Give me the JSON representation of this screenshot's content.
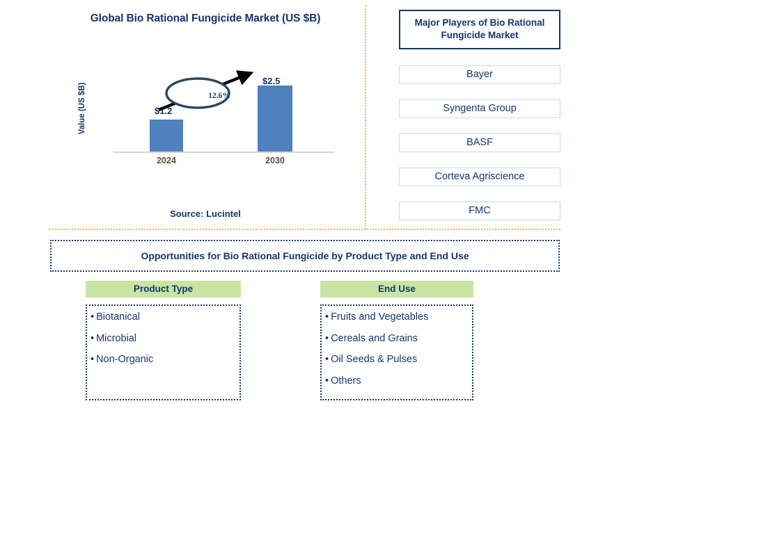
{
  "chart_panel": {
    "title": "Global Bio Rational Fungicide Market (US $B)",
    "y_axis_label": "Value (US $B)",
    "source": "Source: Lucintel",
    "cagr_label": "12.6%"
  },
  "chart_data": {
    "type": "bar",
    "title": "Global Bio Rational Fungicide Market (US $B)",
    "categories": [
      "2024",
      "2030"
    ],
    "values": [
      1.2,
      2.5
    ],
    "value_labels": [
      "$1.2",
      "$2.5"
    ],
    "xlabel": "",
    "ylabel": "Value (US $B)",
    "ylim": [
      0,
      2.9
    ],
    "grid": false,
    "legend": "none",
    "annotations": [
      {
        "text": "12.6%",
        "kind": "cagr-ellipse",
        "from": "2024",
        "to": "2030"
      }
    ],
    "series_color": "#4e81bd",
    "source": "Source: Lucintel"
  },
  "players": {
    "header": "Major Players of Bio Rational Fungicide Market",
    "items": [
      {
        "label": "Bayer"
      },
      {
        "label": "Syngenta Group"
      },
      {
        "label": "BASF"
      },
      {
        "label": "Corteva Agriscience"
      },
      {
        "label": "FMC"
      }
    ]
  },
  "opportunities": {
    "banner": "Opportunities for Bio Rational Fungicide by Product Type and End Use",
    "columns": [
      {
        "header": "Product Type",
        "items": [
          "Biotanical",
          "Microbial",
          "Non-Organic"
        ]
      },
      {
        "header": "End Use",
        "items": [
          "Fruits and Vegetables",
          "Cereals and Grains",
          "Oil Seeds & Pulses",
          "Others"
        ]
      }
    ]
  },
  "colors": {
    "navy": "#17356b",
    "bar_blue": "#4e81bd",
    "amber_divider": "#f5b731",
    "green_header": "#c9e5a4",
    "category_label": "#595138"
  },
  "bullet": "•"
}
